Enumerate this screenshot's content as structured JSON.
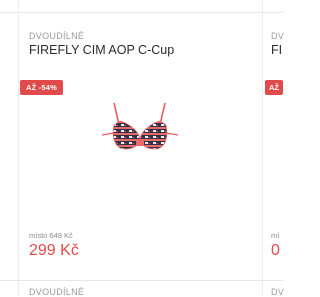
{
  "product": {
    "category": "DVOUDÍLNÉ",
    "title": "FIREFLY CIM AOP C-Cup",
    "badge": "AŽ -54%",
    "old_price": "místo 649 Kč",
    "price": "299 Kč",
    "image_icon": "bikini-top-image"
  },
  "next_product": {
    "category": "DV",
    "title": "FI",
    "badge": "AŽ",
    "old_price": "mí",
    "price": "0"
  },
  "bottom_row": {
    "category": "DVOUDÍLNÉ",
    "next_category": "DV"
  },
  "colors": {
    "accent": "#e04a4a",
    "muted": "#9a9a9a",
    "text": "#2b2b2b"
  }
}
